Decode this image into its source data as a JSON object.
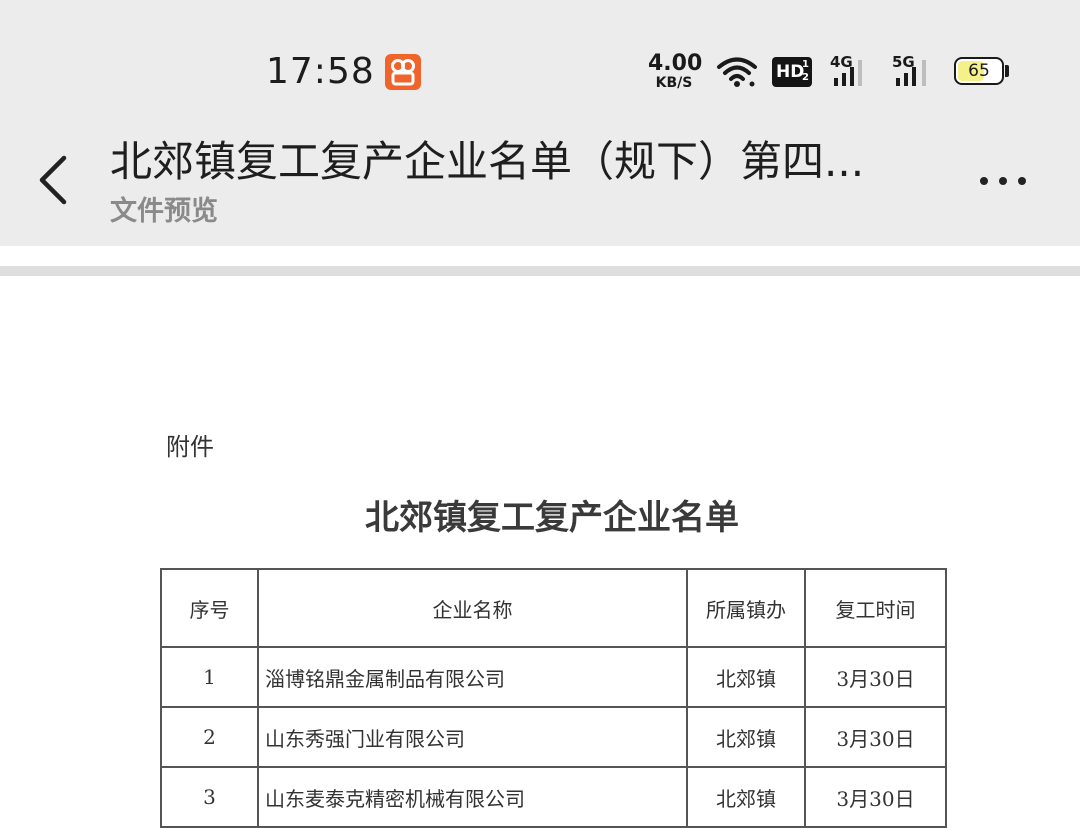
{
  "status_bar": {
    "time": "17:58",
    "net_speed_value": "4.00",
    "net_speed_unit": "KB/S",
    "hd_label": "HD",
    "hd_sup_top": "1",
    "hd_sup_bottom": "2",
    "signal_1_label": "4G",
    "signal_2_label": "5G",
    "battery_level": "65"
  },
  "header": {
    "title": "北郊镇复工复产企业名单（规下）第四...",
    "subtitle": "文件预览",
    "back_icon": "chevron-left-icon",
    "more_icon": "more-horizontal-icon"
  },
  "document": {
    "attachment_label": "附件",
    "heading": "北郊镇复工复产企业名单",
    "table": {
      "columns": [
        "序号",
        "企业名称",
        "所属镇办",
        "复工时间"
      ],
      "rows": [
        {
          "no": "1",
          "company": "淄博铭鼎金属制品有限公司",
          "town": "北郊镇",
          "date": "3月30日"
        },
        {
          "no": "2",
          "company": "山东秀强门业有限公司",
          "town": "北郊镇",
          "date": "3月30日"
        },
        {
          "no": "3",
          "company": "山东麦泰克精密机械有限公司",
          "town": "北郊镇",
          "date": "3月30日"
        }
      ]
    }
  },
  "colors": {
    "chrome_bg": "#ececec",
    "app_badge": "#f0642c",
    "battery_fill": "#f6f08a",
    "title_text": "#1e1e1e",
    "subtitle_text": "#8a8a8a"
  }
}
